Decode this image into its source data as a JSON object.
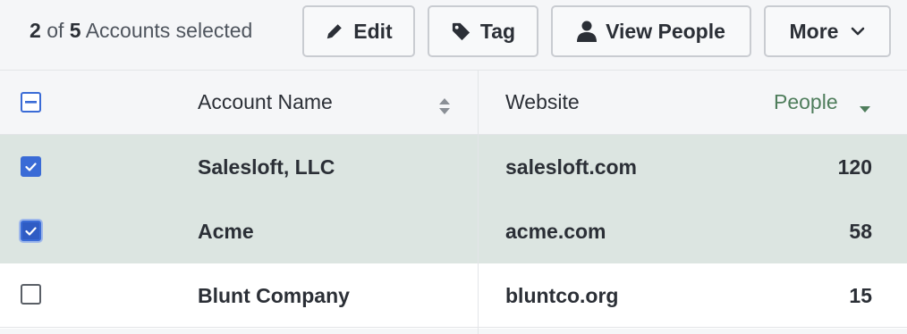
{
  "toolbar": {
    "selection": {
      "selected": "2",
      "of_label": "of",
      "total": "5",
      "suffix": "Accounts selected"
    },
    "edit_label": "Edit",
    "tag_label": "Tag",
    "view_people_label": "View People",
    "more_label": "More"
  },
  "table": {
    "headers": {
      "account_name": "Account Name",
      "website": "Website",
      "people": "People"
    },
    "header_checkbox_state": "indeterminate",
    "people_header_color": "#4f7d5c",
    "selected_row_color": "#dce5e1",
    "checkbox_color": "#3a6bd6",
    "rows": [
      {
        "account_name": "Salesloft, LLC",
        "website": "salesloft.com",
        "people": "120",
        "checked": true
      },
      {
        "account_name": "Acme",
        "website": "acme.com",
        "people": "58",
        "checked": true,
        "focused": true
      },
      {
        "account_name": "Blunt Company",
        "website": "bluntco.org",
        "people": "15",
        "checked": false
      }
    ]
  },
  "icons": {
    "edit": "pencil-icon",
    "tag": "tag-icon",
    "view_people": "person-icon",
    "more": "chevron-down-icon",
    "account_sort": "sort-both-icon",
    "people_sort": "sort-desc-icon"
  }
}
